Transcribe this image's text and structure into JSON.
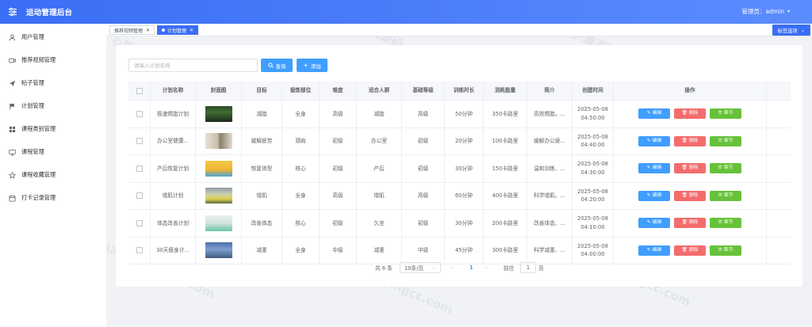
{
  "header": {
    "title": "运动管理后台",
    "admin_label": "管理员：admin"
  },
  "sidebar": {
    "items": [
      {
        "label": "用户管理",
        "icon": "user-icon"
      },
      {
        "label": "推荐视频管理",
        "icon": "video-icon"
      },
      {
        "label": "帖子管理",
        "icon": "send-icon"
      },
      {
        "label": "计划管理",
        "icon": "flag-icon"
      },
      {
        "label": "课程类别管理",
        "icon": "grid-icon"
      },
      {
        "label": "课程管理",
        "icon": "monitor-icon"
      },
      {
        "label": "课程收藏管理",
        "icon": "star-icon"
      },
      {
        "label": "打卡记录管理",
        "icon": "calendar-icon"
      }
    ]
  },
  "tabs": [
    {
      "label": "推荐视频管理",
      "active": false
    },
    {
      "label": "计划管理",
      "active": true
    }
  ],
  "tag_options_label": "标签选项",
  "search": {
    "placeholder": "请输入计划名称",
    "query_label": "查询",
    "add_label": "添加"
  },
  "table": {
    "columns": [
      "计划名称",
      "封面图",
      "目标",
      "锻炼部位",
      "难度",
      "适合人群",
      "基础等级",
      "训练时长",
      "消耗能量",
      "简介",
      "创建时间",
      "操作"
    ],
    "rows": [
      {
        "name": "极速燃脂计划",
        "goal": "减脂",
        "part": "全身",
        "difficulty": "高级",
        "crowd": "减脂",
        "level": "高级",
        "duration": "50分钟",
        "energy": "350卡路里",
        "intro": "高效燃脂，...",
        "date": "2025-05-08",
        "time": "04:50:00"
      },
      {
        "name": "办公室健康...",
        "goal": "缓解疲劳",
        "part": "颈肩",
        "difficulty": "初级",
        "crowd": "办公室",
        "level": "初级",
        "duration": "20分钟",
        "energy": "100卡路里",
        "intro": "缓解办公疲...",
        "date": "2025-05-08",
        "time": "04:40:00"
      },
      {
        "name": "产后恢复计划",
        "goal": "恢复体型",
        "part": "核心",
        "difficulty": "初级",
        "crowd": "产后",
        "level": "初级",
        "duration": "30分钟",
        "energy": "150卡路里",
        "intro": "温和训练、...",
        "date": "2025-05-08",
        "time": "04:30:00"
      },
      {
        "name": "增肌计划",
        "goal": "增肌",
        "part": "全身",
        "difficulty": "高级",
        "crowd": "增肌",
        "level": "高级",
        "duration": "60分钟",
        "energy": "400卡路里",
        "intro": "科学增肌、...",
        "date": "2025-05-08",
        "time": "04:20:00"
      },
      {
        "name": "体态改善计划",
        "goal": "改善体态",
        "part": "核心",
        "difficulty": "初级",
        "crowd": "久坐",
        "level": "初级",
        "duration": "30分钟",
        "energy": "200卡路里",
        "intro": "改善体态、...",
        "date": "2025-05-08",
        "time": "04:10:00"
      },
      {
        "name": "30天瘦身计...",
        "goal": "减重",
        "part": "全身",
        "difficulty": "中级",
        "crowd": "减重",
        "level": "中级",
        "duration": "45分钟",
        "energy": "300卡路里",
        "intro": "科学减重、...",
        "date": "2025-05-08",
        "time": "04:00:00"
      }
    ],
    "actions": {
      "edit": "编辑",
      "delete": "删除",
      "chapter": "章节"
    }
  },
  "pagination": {
    "total": "共 6 条",
    "page_size": "10条/页",
    "current": "1",
    "goto_label": "前往",
    "goto_value": "1",
    "page_suffix": "页"
  },
  "watermark": "www.maotouyingcc.com",
  "colors": {
    "primary": "#409eff",
    "danger": "#f56c6c",
    "success": "#67c23a",
    "header": "#3a6ef5"
  }
}
